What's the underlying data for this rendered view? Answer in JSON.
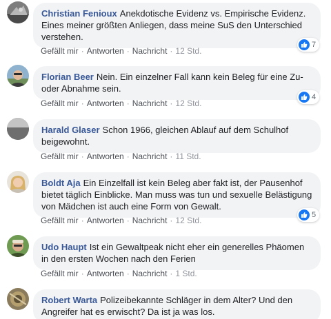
{
  "colors": {
    "author": "#385898",
    "bubble": "#f2f3f5",
    "like": "#1877f2",
    "meta": "#90949c"
  },
  "comments": [
    {
      "author": "Christian Fenioux",
      "text": "Anekdotische Evidenz vs. Empirische Evidenz. Eines meiner größten Anliegen, dass meine SuS den Unterschied verstehen.",
      "like": "Gefällt mir",
      "reply": "Antworten",
      "report": "Nachricht",
      "time": "12 Std.",
      "reaction_icon": "like-icon",
      "reactions": "7"
    },
    {
      "author": "Florian Beer",
      "text": "Nein. Ein einzelner Fall kann kein Beleg für eine Zu- oder Abnahme sein.",
      "like": "Gefällt mir",
      "reply": "Antworten",
      "report": "Nachricht",
      "time": "12 Std.",
      "reaction_icon": "like-icon",
      "reactions": "4"
    },
    {
      "author": "Harald Glaser",
      "text": "Schon 1966, gleichen Ablauf auf dem Schulhof beigewohnt.",
      "like": "Gefällt mir",
      "reply": "Antworten",
      "report": "Nachricht",
      "time": "11 Std."
    },
    {
      "author": "Boldt Aja",
      "text": "Ein Einzelfall ist kein Beleg aber fakt ist, der Pausenhof bietet täglich Einblicke. Man muss was tun und sexuelle Belästigung von Mädchen ist auch eine Form von Gewalt.",
      "like": "Gefällt mir",
      "reply": "Antworten",
      "report": "Nachricht",
      "time": "12 Std.",
      "reaction_icon": "like-icon",
      "reactions": "5"
    },
    {
      "author": "Udo Haupt",
      "text": "Ist ein Gewaltpeak nicht eher ein generelles Phäomen in den ersten Wochen nach den Ferien",
      "like": "Gefällt mir",
      "reply": "Antworten",
      "report": "Nachricht",
      "time": "1 Std."
    },
    {
      "author": "Robert Warta",
      "text": "Polizeibekannte Schläger in dem Alter? Und den Angreifer hat es erwischt? Da ist ja was los."
    }
  ]
}
